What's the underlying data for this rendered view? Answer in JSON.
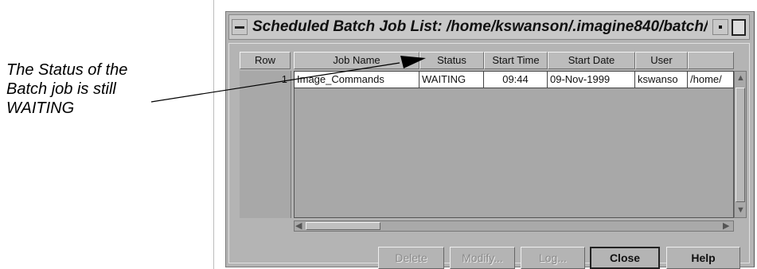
{
  "callout": {
    "lines": [
      "The Status of the",
      "Batch job is still",
      "WAITING"
    ]
  },
  "window": {
    "title": "Scheduled Batch Job List: /home/kswanson/.imagine840/batch/",
    "columns": [
      "Row",
      "Job Name",
      "Status",
      "Start Time",
      "Start Date",
      "User"
    ],
    "rows": [
      {
        "row": "1",
        "job_name": "Image_Commands",
        "status": "WAITING",
        "start_time": "09:44",
        "start_date": "09-Nov-1999",
        "user": "kswanso",
        "path": "/home/"
      }
    ],
    "buttons": {
      "delete": "Delete",
      "modify": "Modify...",
      "log": "Log...",
      "close": "Close",
      "help": "Help"
    }
  }
}
